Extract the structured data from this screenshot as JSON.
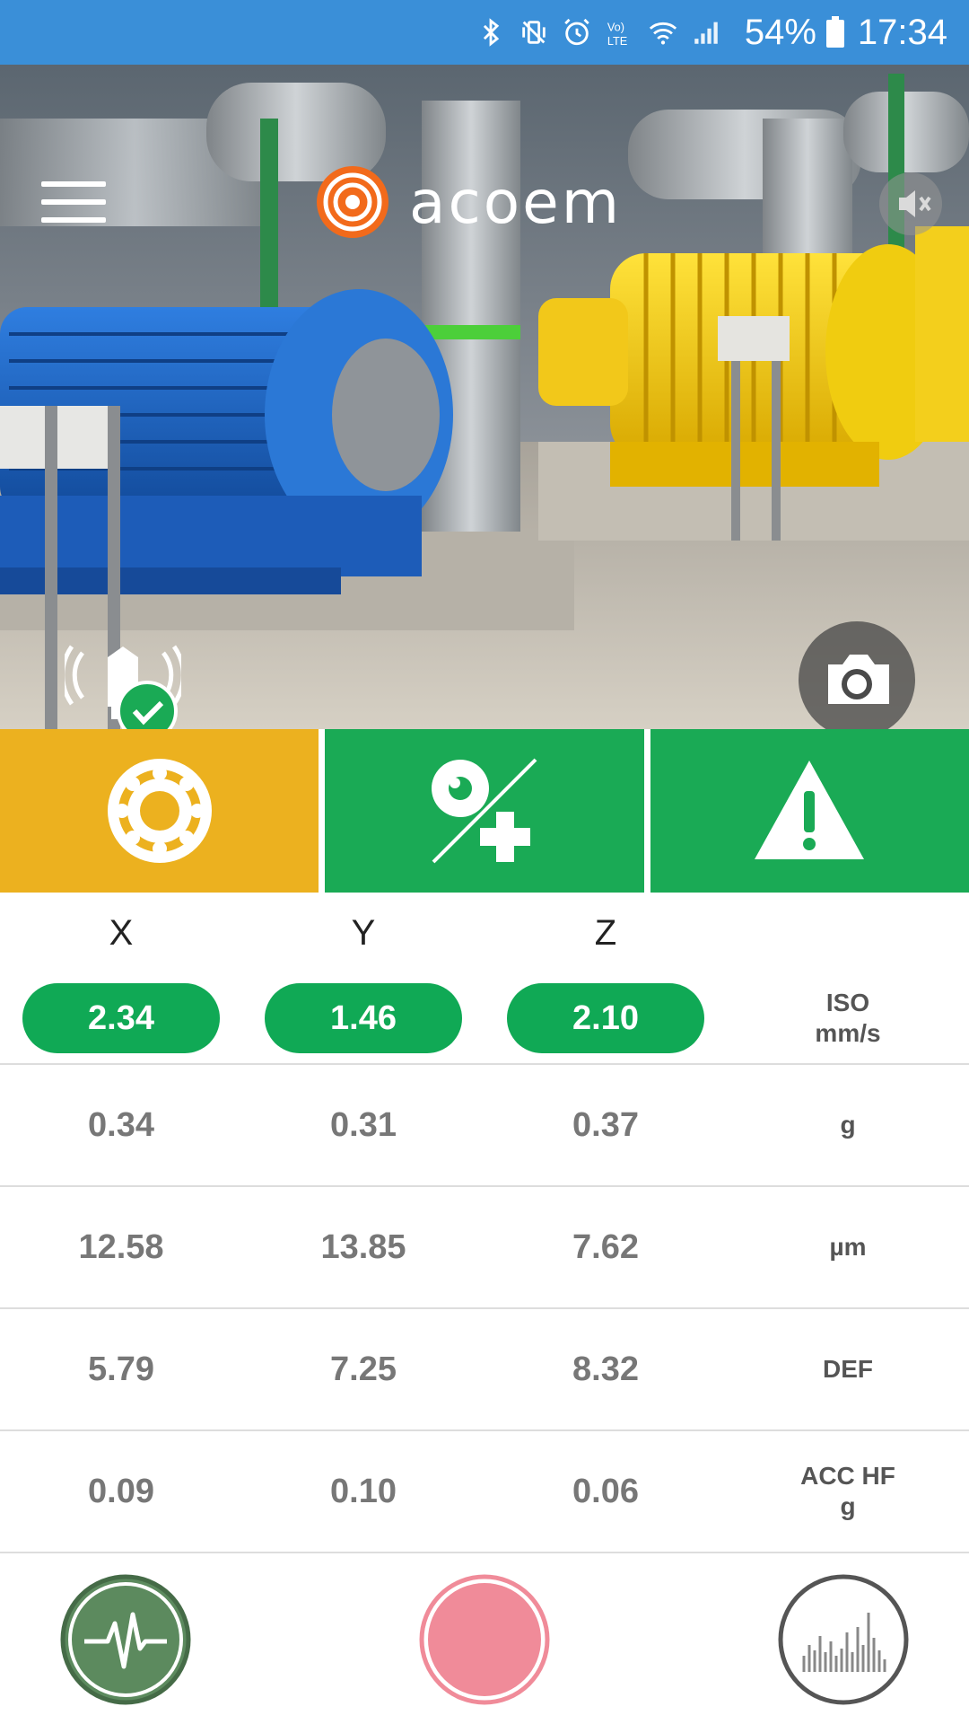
{
  "status_bar": {
    "battery": "54%",
    "time": "17:34",
    "icons": [
      "bluetooth-icon",
      "vibrate-icon",
      "alarm-icon",
      "volte-icon",
      "wifi-icon",
      "signal-icon",
      "battery-icon"
    ],
    "bg_color": "#3a8fd8"
  },
  "header": {
    "logo_text": "acoem",
    "menu_icon": "hamburger-icon",
    "sound_icon": "mute-icon"
  },
  "hero": {
    "sensor_status": "connected",
    "camera_icon": "camera-icon"
  },
  "status_tiles": [
    {
      "icon": "bearing-icon",
      "color": "#ecb11f"
    },
    {
      "icon": "alignment-icon",
      "color": "#1aaa55"
    },
    {
      "icon": "warning-icon",
      "color": "#1aaa55"
    }
  ],
  "table": {
    "headers": [
      "X",
      "Y",
      "Z"
    ],
    "iso": {
      "values": [
        "2.34",
        "1.46",
        "2.10"
      ],
      "unit_line1": "ISO",
      "unit_line2": "mm/s"
    },
    "rows": [
      {
        "values": [
          "0.34",
          "0.31",
          "0.37"
        ],
        "unit_line1": "g",
        "unit_line2": ""
      },
      {
        "values": [
          "12.58",
          "13.85",
          "7.62"
        ],
        "unit_line1": "µm",
        "unit_line2": ""
      },
      {
        "values": [
          "5.79",
          "7.25",
          "8.32"
        ],
        "unit_line1": "DEF",
        "unit_line2": ""
      },
      {
        "values": [
          "0.09",
          "0.10",
          "0.06"
        ],
        "unit_line1": "ACC HF",
        "unit_line2": "g"
      }
    ]
  },
  "footer": {
    "buttons": [
      "waveform-icon",
      "record-icon",
      "spectrum-icon"
    ]
  }
}
